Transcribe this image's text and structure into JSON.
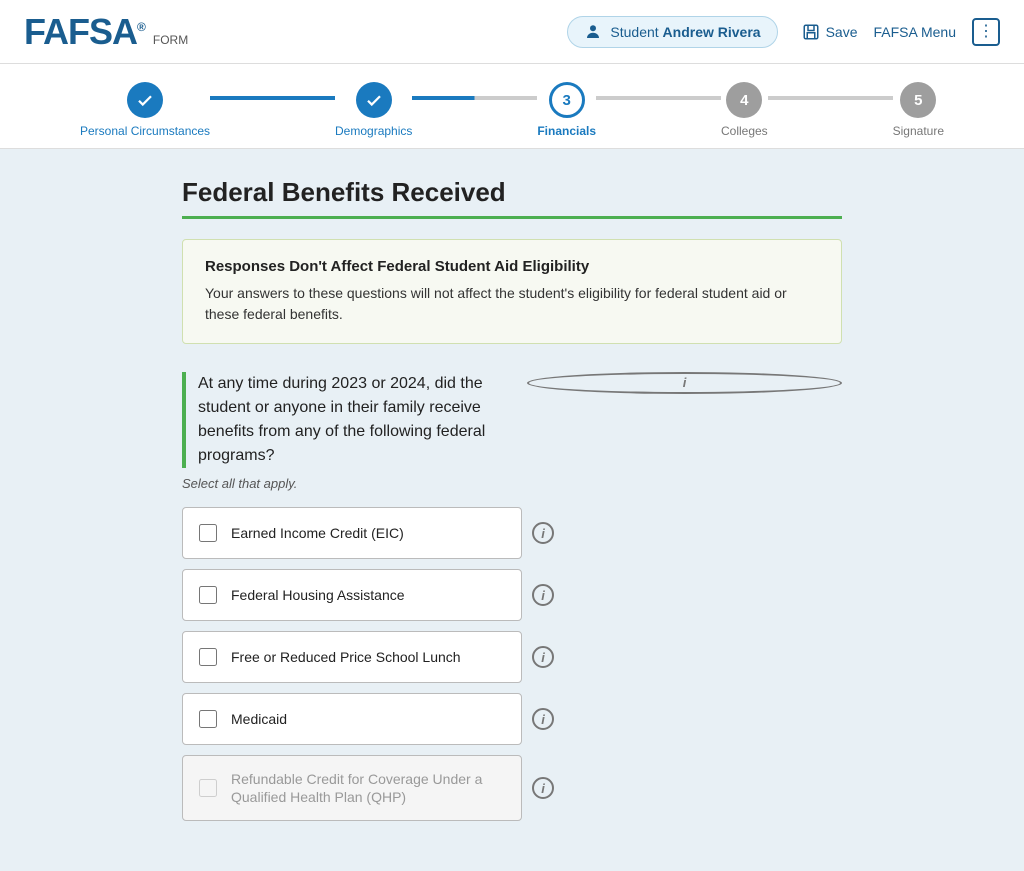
{
  "header": {
    "logo": "FAFSA",
    "logo_reg": "®",
    "logo_form": "FORM",
    "student_label": "Student",
    "student_name": "Andrew Rivera",
    "save_label": "Save",
    "menu_label": "FAFSA Menu"
  },
  "progress": {
    "steps": [
      {
        "id": 1,
        "label": "Personal Circumstances",
        "state": "completed"
      },
      {
        "id": 2,
        "label": "Demographics",
        "state": "completed"
      },
      {
        "id": 3,
        "label": "Financials",
        "state": "active"
      },
      {
        "id": 4,
        "label": "Colleges",
        "state": "inactive"
      },
      {
        "id": 5,
        "label": "Signature",
        "state": "inactive"
      }
    ]
  },
  "page": {
    "title": "Federal Benefits Received",
    "info_box": {
      "title": "Responses Don't Affect Federal Student Aid Eligibility",
      "text": "Your answers to these questions will not affect the student's eligibility for federal student aid or these federal benefits."
    },
    "question": "At any time during 2023 or 2024, did the student or anyone in their family receive benefits from any of the following federal programs?",
    "select_all_text": "Select all that apply.",
    "checkboxes": [
      {
        "id": "eic",
        "label": "Earned Income Credit (EIC)",
        "checked": false,
        "disabled": false
      },
      {
        "id": "fha",
        "label": "Federal Housing Assistance",
        "checked": false,
        "disabled": false
      },
      {
        "id": "frpsl",
        "label": "Free or Reduced Price School Lunch",
        "checked": false,
        "disabled": false
      },
      {
        "id": "medicaid",
        "label": "Medicaid",
        "checked": false,
        "disabled": false
      },
      {
        "id": "rcqhp",
        "label": "Refundable Credit for Coverage Under a Qualified Health Plan (QHP)",
        "checked": false,
        "disabled": true
      }
    ]
  }
}
